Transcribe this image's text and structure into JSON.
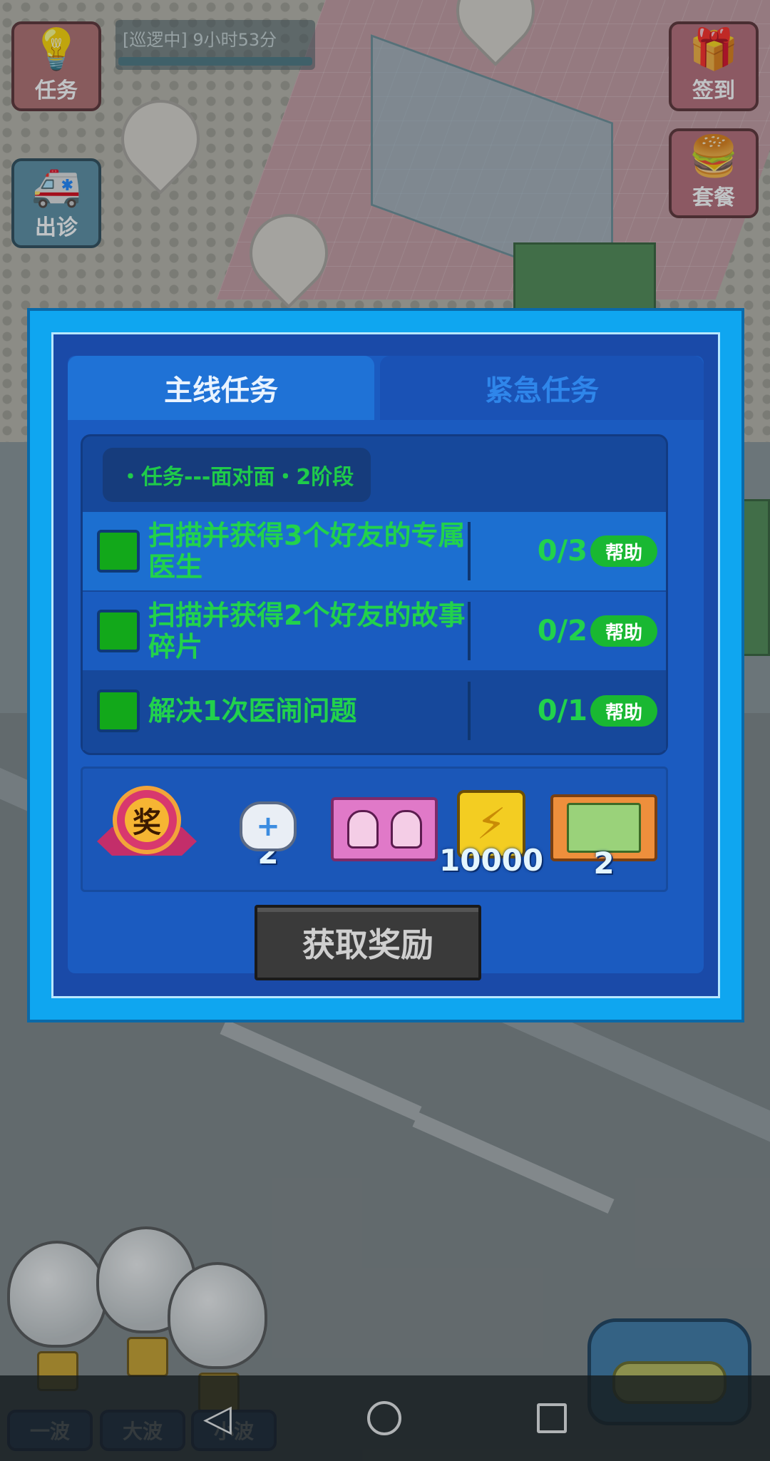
{
  "hud": {
    "task_label": "任务",
    "visit_label": "出诊",
    "sign_label": "签到",
    "combo_label": "套餐",
    "patrol_text": "[巡逻中] 9小时53分"
  },
  "dialog": {
    "tabs": [
      {
        "label": "主线任务",
        "active": true
      },
      {
        "label": "紧急任务",
        "active": false
      }
    ],
    "stage_title": "・任务---面对面・2阶段",
    "tasks": [
      {
        "text": "扫描并获得3个好友的专属医生",
        "progress": "0/3",
        "help": "帮助"
      },
      {
        "text": "扫描并获得2个好友的故事碎片",
        "progress": "0/2",
        "help": "帮助"
      },
      {
        "text": "解决1次医闹问题",
        "progress": "0/1",
        "help": "帮助"
      }
    ],
    "rewards": {
      "medal_char": "奖",
      "medal_icon": "award-medal-icon",
      "cat_count": "2",
      "cat_icon": "doctor-cat-icon",
      "card_icon": "story-card-icon",
      "energy_count": "10000",
      "energy_icon": "lightning-energy-icon",
      "ticket_count": "2",
      "ticket_icon": "doctor-ticket-icon"
    },
    "claim_label": "获取奖励"
  },
  "waves": {
    "one": "一波",
    "big": "大波",
    "small": "小波"
  },
  "colors": {
    "dialog_frame": "#0fa6f0",
    "task_text": "#22d24c",
    "help_button": "#19b832"
  }
}
